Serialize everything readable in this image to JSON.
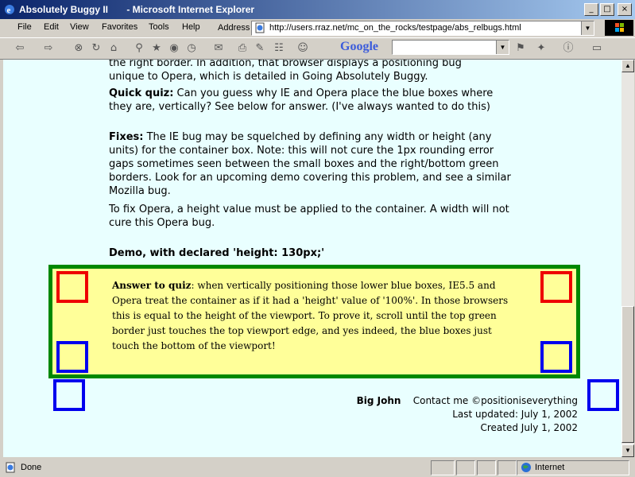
{
  "window": {
    "title": "Absolutely Buggy II       - Microsoft Internet Explorer",
    "buttons": [
      "_",
      "□",
      "×"
    ]
  },
  "menu": [
    "File",
    "Edit",
    "View",
    "Favorites",
    "Tools",
    "Help"
  ],
  "address": {
    "label": "Address",
    "url": "http://users.rraz.net/mc_on_the_rocks/testpage/abs_relbugs.html"
  },
  "toolbar": {
    "google_label": "Google"
  },
  "content": {
    "intro_line1": "the right border. In addition, that browser displays a positioning bug",
    "intro_line2": "unique to Opera, which is detailed in Going Absolutely Buggy.",
    "quiz_label": "Quick quiz:",
    "quiz_text": " Can you guess why IE and Opera place the blue boxes where they are, vertically? See below for answer. (I've always wanted to do this)",
    "fixes_label": "Fixes:",
    "fixes_text": " The IE bug may be squelched by defining any width or height (any units) for the container box. Note: this will not cure the 1px rounding error gaps sometimes seen between the small boxes and the right/bottom green borders. Look for an upcoming demo covering this problem, and see a similar Mozilla bug.",
    "opera_text": "To fix Opera, a height value must be applied to the container. A width will not cure this Opera bug.",
    "demo_heading": "Demo, with declared 'height: 130px;'",
    "answer_label": "Answer to quiz",
    "answer_text": ": when vertically positioning those lower blue boxes, IE5.5 and Opera treat the container as if it had a 'height' value of '100%'. In those browsers this is equal to the height of the viewport. To prove it, scroll until the top green border just touches the top viewport edge, and yes indeed, the blue boxes just touch the bottom of the viewport!"
  },
  "footer": {
    "author": "Big John",
    "contact": "Contact me ©positioniseverything",
    "updated": "Last updated: July 1, 2002",
    "created": "Created July 1, 2002"
  },
  "status": {
    "left": "Done",
    "zone": "Internet"
  },
  "colors": {
    "page_bg": "#e9ffff",
    "container_bg": "#ffff99",
    "container_border": "#008800",
    "red_box": "#ee0000",
    "blue_box": "#0000ee"
  }
}
